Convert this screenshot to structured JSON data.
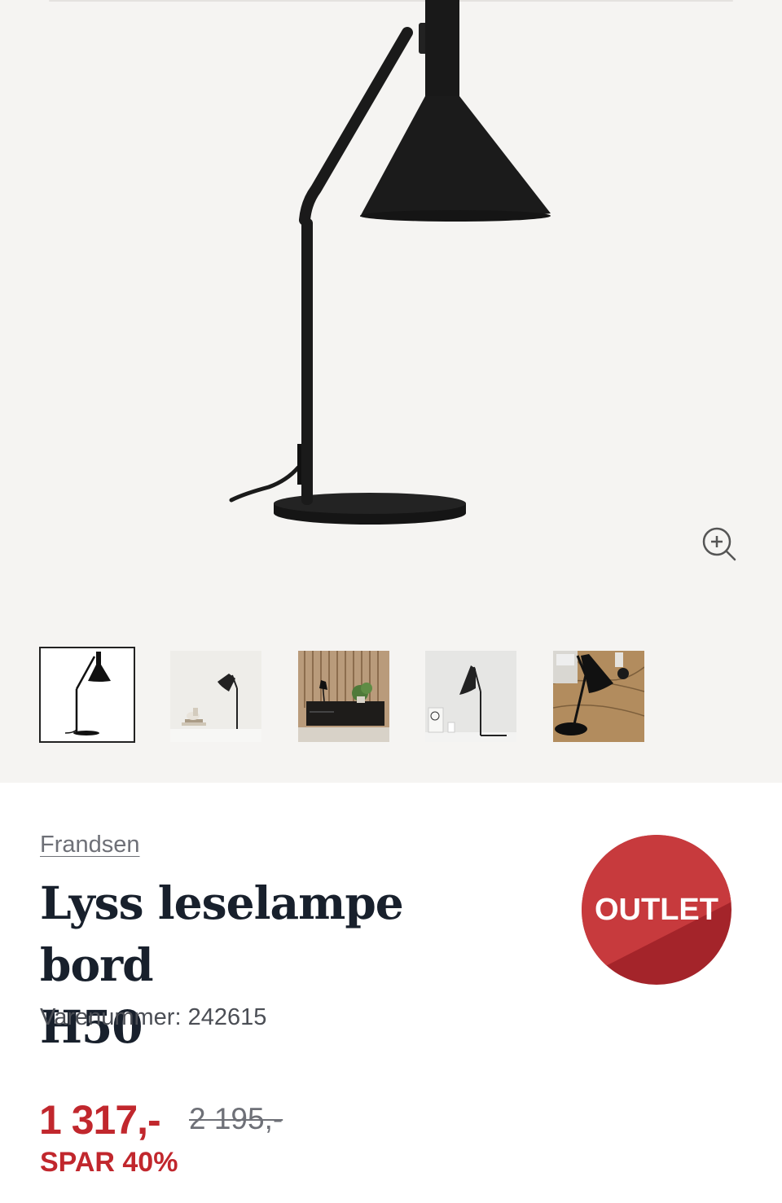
{
  "gallery": {
    "main_image_alt": "Lyss leselampe bord H50",
    "zoom_icon": "zoom-in-icon",
    "thumbnails": [
      {
        "name": "thumbnail-1",
        "active": true
      },
      {
        "name": "thumbnail-2",
        "active": false
      },
      {
        "name": "thumbnail-3",
        "active": false
      },
      {
        "name": "thumbnail-4",
        "active": false
      },
      {
        "name": "thumbnail-5",
        "active": false
      }
    ]
  },
  "product": {
    "brand": "Frandsen",
    "title_line1": "Lyss leselampe bord",
    "title_line2": "H50",
    "sku": "Varenummer: 242615",
    "badge": "OUTLET",
    "price": "1 317,-",
    "old_price": "2 195,-",
    "savings": "SPAR 40%"
  },
  "colors": {
    "sale_red": "#c1272d",
    "badge_red": "#a4242a",
    "gallery_bg": "#f5f4f2",
    "text_dark": "#18202c"
  }
}
